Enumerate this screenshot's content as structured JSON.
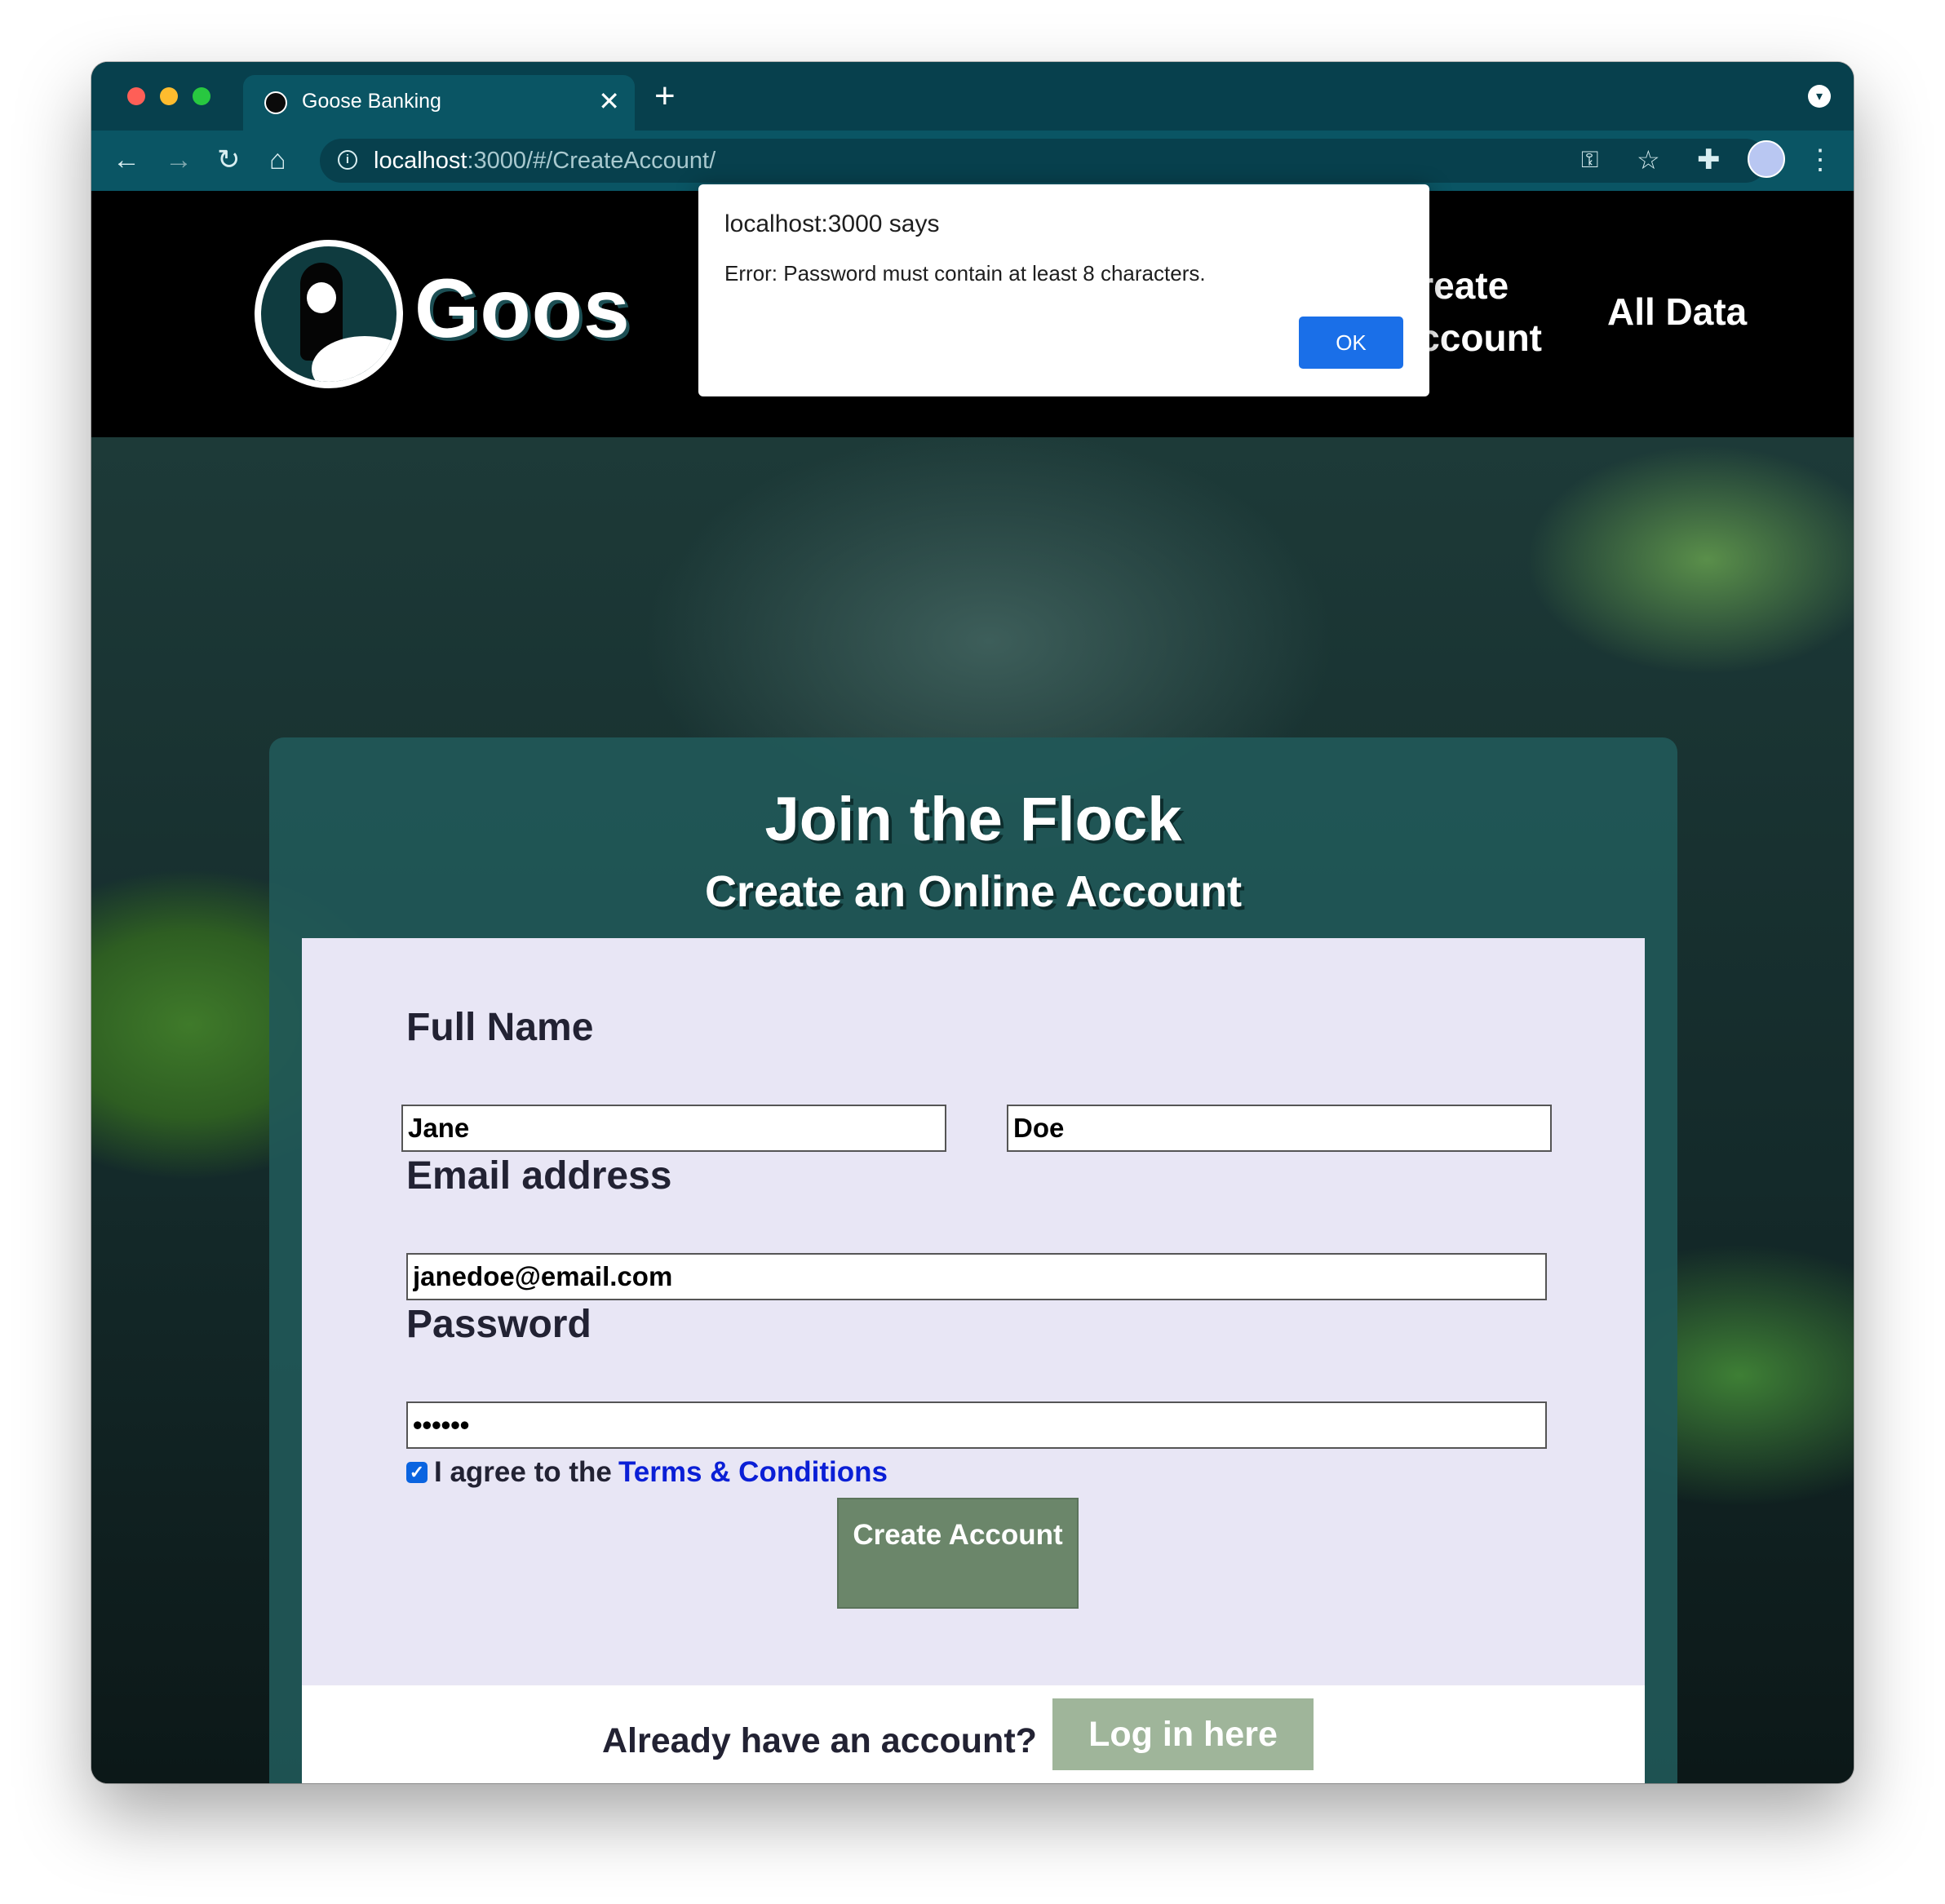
{
  "browser": {
    "tab_title": "Goose Banking",
    "tab_close": "✕",
    "new_tab": "+",
    "url_host": "localhost",
    "url_path": ":3000/#/CreateAccount/"
  },
  "navbar": {
    "brand": "Goos",
    "links": [
      "Create Account",
      "All Data"
    ]
  },
  "card": {
    "title": "Join the Flock",
    "subtitle": "Create an Online Account"
  },
  "form": {
    "full_name_label": "Full Name",
    "first_name_value": "Jane",
    "last_name_value": "Doe",
    "email_label": "Email address",
    "email_value": "janedoe@email.com",
    "password_label": "Password",
    "password_value": "••••••",
    "agree_checked": true,
    "agree_text": "I agree to the",
    "terms_link": "Terms & Conditions",
    "submit_label": "Create Account"
  },
  "login": {
    "prompt": "Already have an account?",
    "button": "Log in here"
  },
  "alert": {
    "title": "localhost:3000 says",
    "message": "Error: Password must contain at least 8 characters.",
    "ok": "OK"
  },
  "colors": {
    "browser_chrome": "#0a5564",
    "card_bg": "#215858",
    "form_bg": "#e8e6f5",
    "submit_button": "#6b866a",
    "login_button": "#9fb59a",
    "link": "#0a1fd6",
    "alert_ok": "#1a6fe8"
  },
  "icons": [
    "back-arrow-icon",
    "forward-arrow-icon",
    "reload-icon",
    "home-icon",
    "info-icon",
    "key-icon",
    "star-icon",
    "extensions-icon",
    "profile-avatar",
    "more-menu-icon",
    "goose-logo"
  ]
}
